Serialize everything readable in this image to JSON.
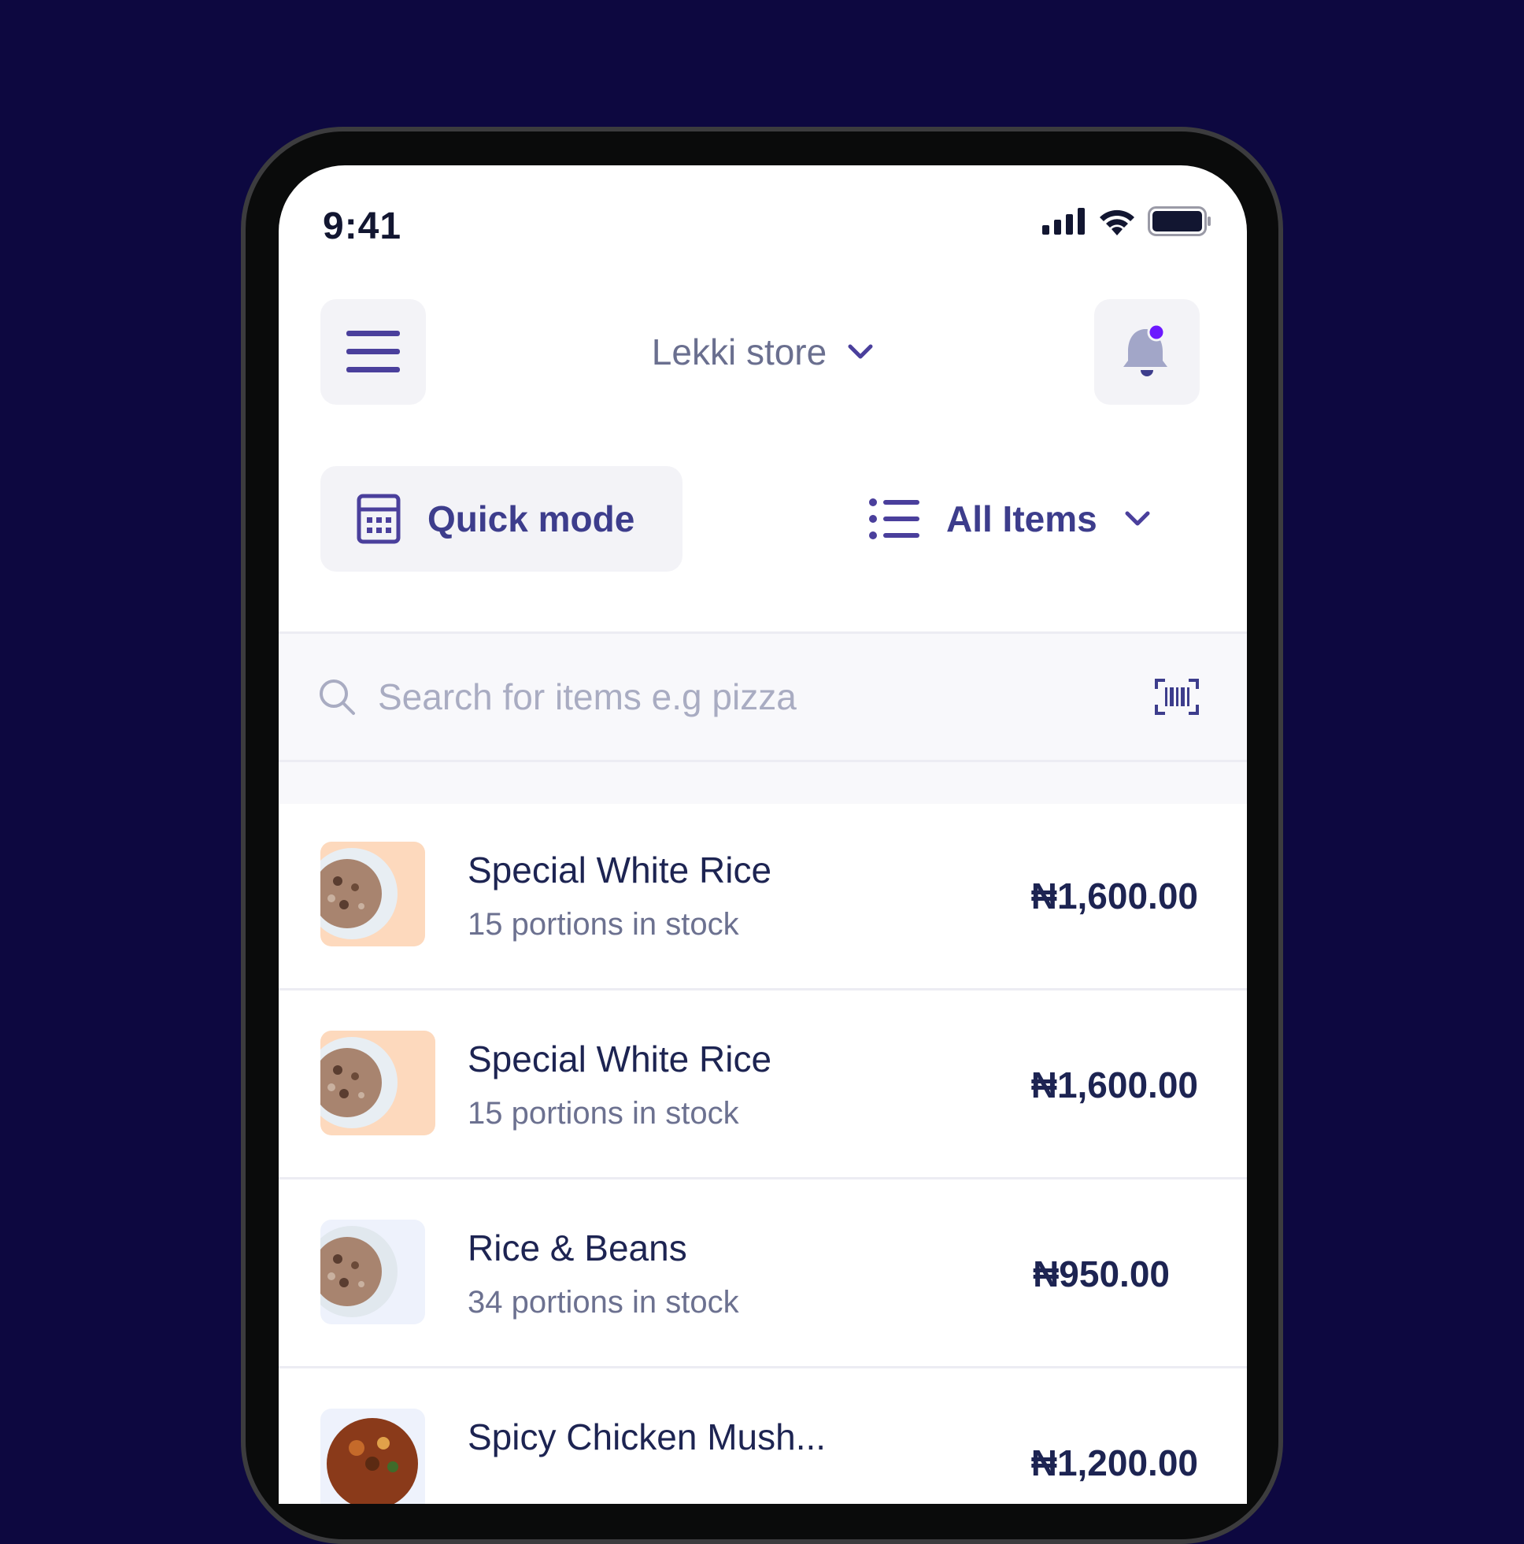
{
  "status_bar": {
    "time": "9:41"
  },
  "header": {
    "store_name": "Lekki store",
    "menu_icon": "hamburger-menu-icon",
    "notification_icon": "bell-icon",
    "notification_dot_color": "#6c18ff"
  },
  "controls": {
    "quick_mode_label": "Quick mode",
    "filter_label": "All Items"
  },
  "search": {
    "placeholder": "Search for items e.g pizza"
  },
  "items": [
    {
      "name": "Special White Rice",
      "stock": "15 portions in stock",
      "price": "₦1,600.00",
      "thumb_bg": "#fdd9bd"
    },
    {
      "name": "Special White Rice",
      "stock": "15 portions in stock",
      "price": "₦1,600.00",
      "thumb_bg": "#fdd9bd"
    },
    {
      "name": "Rice & Beans",
      "stock": "34 portions in stock",
      "price": "₦950.00",
      "thumb_bg": "#eef2fc"
    },
    {
      "name": "Spicy Chicken Mush...",
      "stock": "",
      "price": "₦1,200.00",
      "thumb_bg": "#eef2fc"
    }
  ],
  "colors": {
    "background": "#0d0840",
    "accent": "#3d3d8c",
    "text_dark": "#1d2452",
    "text_muted": "#6c7190"
  }
}
